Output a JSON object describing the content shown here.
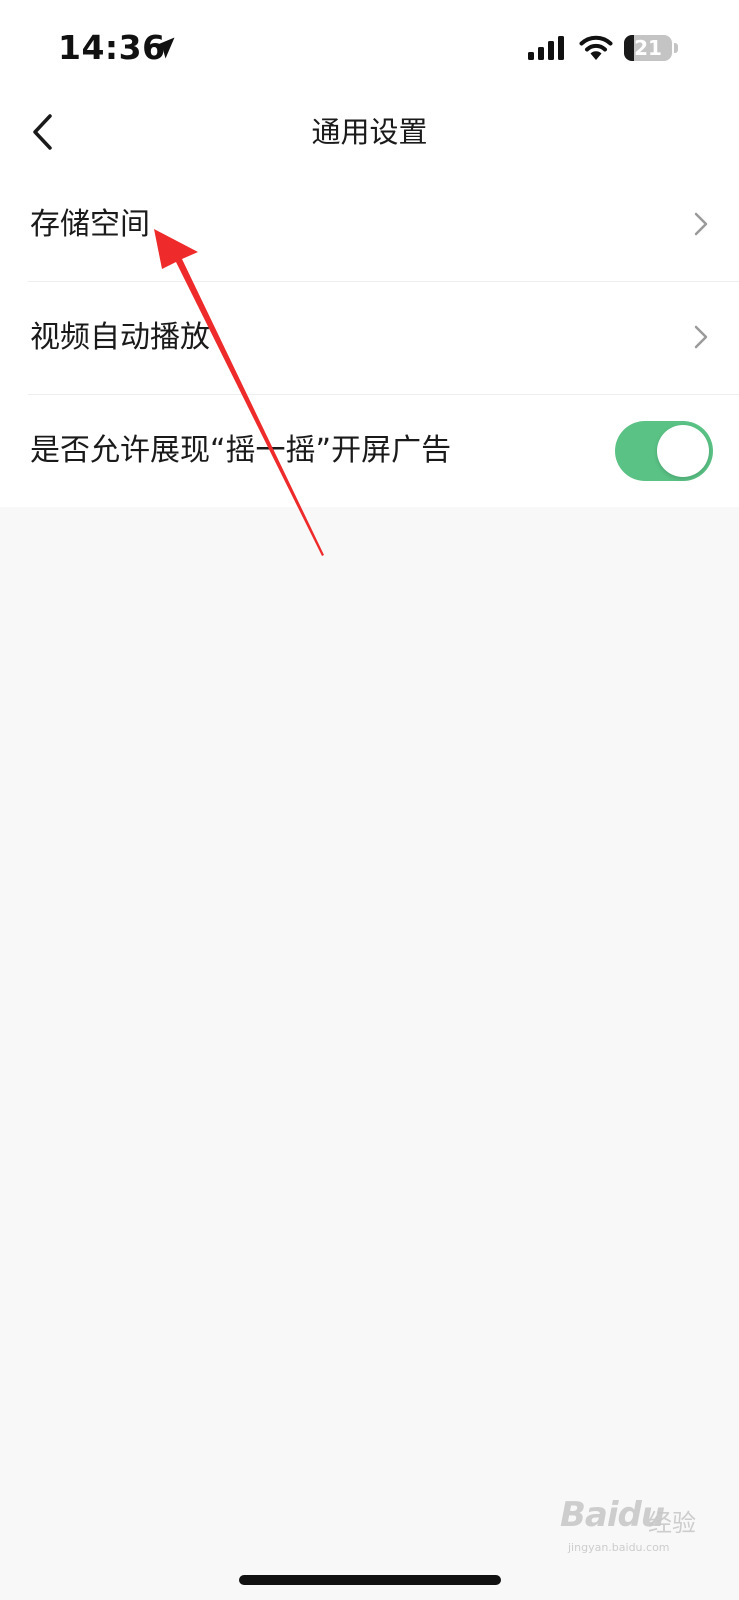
{
  "status_bar": {
    "time": "14:36",
    "battery_level": "21",
    "battery_fraction": 0.21
  },
  "nav": {
    "title": "通用设置",
    "back_icon": "chevron-left-icon"
  },
  "settings": {
    "items": [
      {
        "label": "存储空间",
        "control": "chevron"
      },
      {
        "label": "视频自动播放",
        "control": "chevron"
      },
      {
        "label": "是否允许展现“摇一摇”开屏广告",
        "control": "toggle",
        "toggle_on": true
      }
    ]
  },
  "colors": {
    "toggle_on": "#5ac285",
    "annotation_arrow": "#ee2a2a",
    "page_background": "#f8f8f8",
    "list_background": "#ffffff"
  },
  "watermark": {
    "logo": "Baidu",
    "text": "经验",
    "url": "jingyan.baidu.com"
  }
}
